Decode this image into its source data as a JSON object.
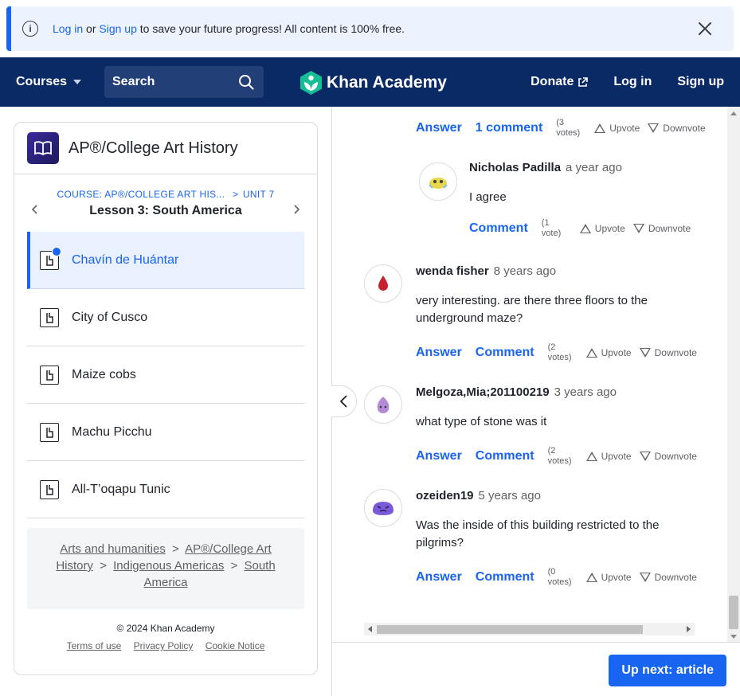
{
  "banner": {
    "login": "Log in",
    "or": "or",
    "signup": "Sign up",
    "rest": "to save your future progress! All content is 100% free."
  },
  "nav": {
    "courses": "Courses",
    "search_placeholder": "Search",
    "logo": "Khan Academy",
    "donate": "Donate",
    "login": "Log in",
    "signup": "Sign up",
    "bg_color": "#0a2a66"
  },
  "sidebar": {
    "course_title": "AP®/College Art History",
    "crumb_course": "COURSE: AP®/COLLEGE ART HIS...",
    "crumb_sep": ">",
    "crumb_unit": "UNIT 7",
    "lesson": "Lesson 3: South America",
    "items": [
      {
        "label": "Chavín de Huántar",
        "active": true
      },
      {
        "label": "City of Cusco"
      },
      {
        "label": "Maize cobs"
      },
      {
        "label": "Machu Picchu"
      },
      {
        "label": "All-T’oqapu Tunic"
      }
    ],
    "breadcrumb": [
      "Arts and humanities",
      "AP®/College Art History",
      "Indigenous Americas",
      "South America"
    ],
    "breadcrumb_sep": ">",
    "copyright": "© 2024 Khan Academy",
    "links": [
      "Terms of use",
      "Privacy Policy",
      "Cookie Notice"
    ]
  },
  "discussion": {
    "answer": "Answer",
    "comment": "Comment",
    "upvote": "Upvote",
    "downvote": "Downvote",
    "top": {
      "comments": "1 comment",
      "votes": "(3 votes)"
    },
    "reply": {
      "author": "Nicholas Padilla",
      "ago": "a year ago",
      "text": "I agree",
      "votes": "(1 vote)"
    },
    "posts": [
      {
        "author": "wenda fisher",
        "ago": "8 years ago",
        "text": "very interesting. are there three floors to the underground maze?",
        "votes": "(2 votes)"
      },
      {
        "author": "Melgoza,Mia;201100219",
        "ago": "3 years ago",
        "text": "what type of stone was it",
        "votes": "(2 votes)"
      },
      {
        "author": "ozeiden19",
        "ago": "5 years ago",
        "text": "Was the inside of this building restricted to the pilgrims?",
        "votes": "(0 votes)"
      }
    ],
    "up_next": "Up next: article"
  },
  "colors": {
    "accent": "#1865f2",
    "active_bg": "#e9f0fe"
  }
}
